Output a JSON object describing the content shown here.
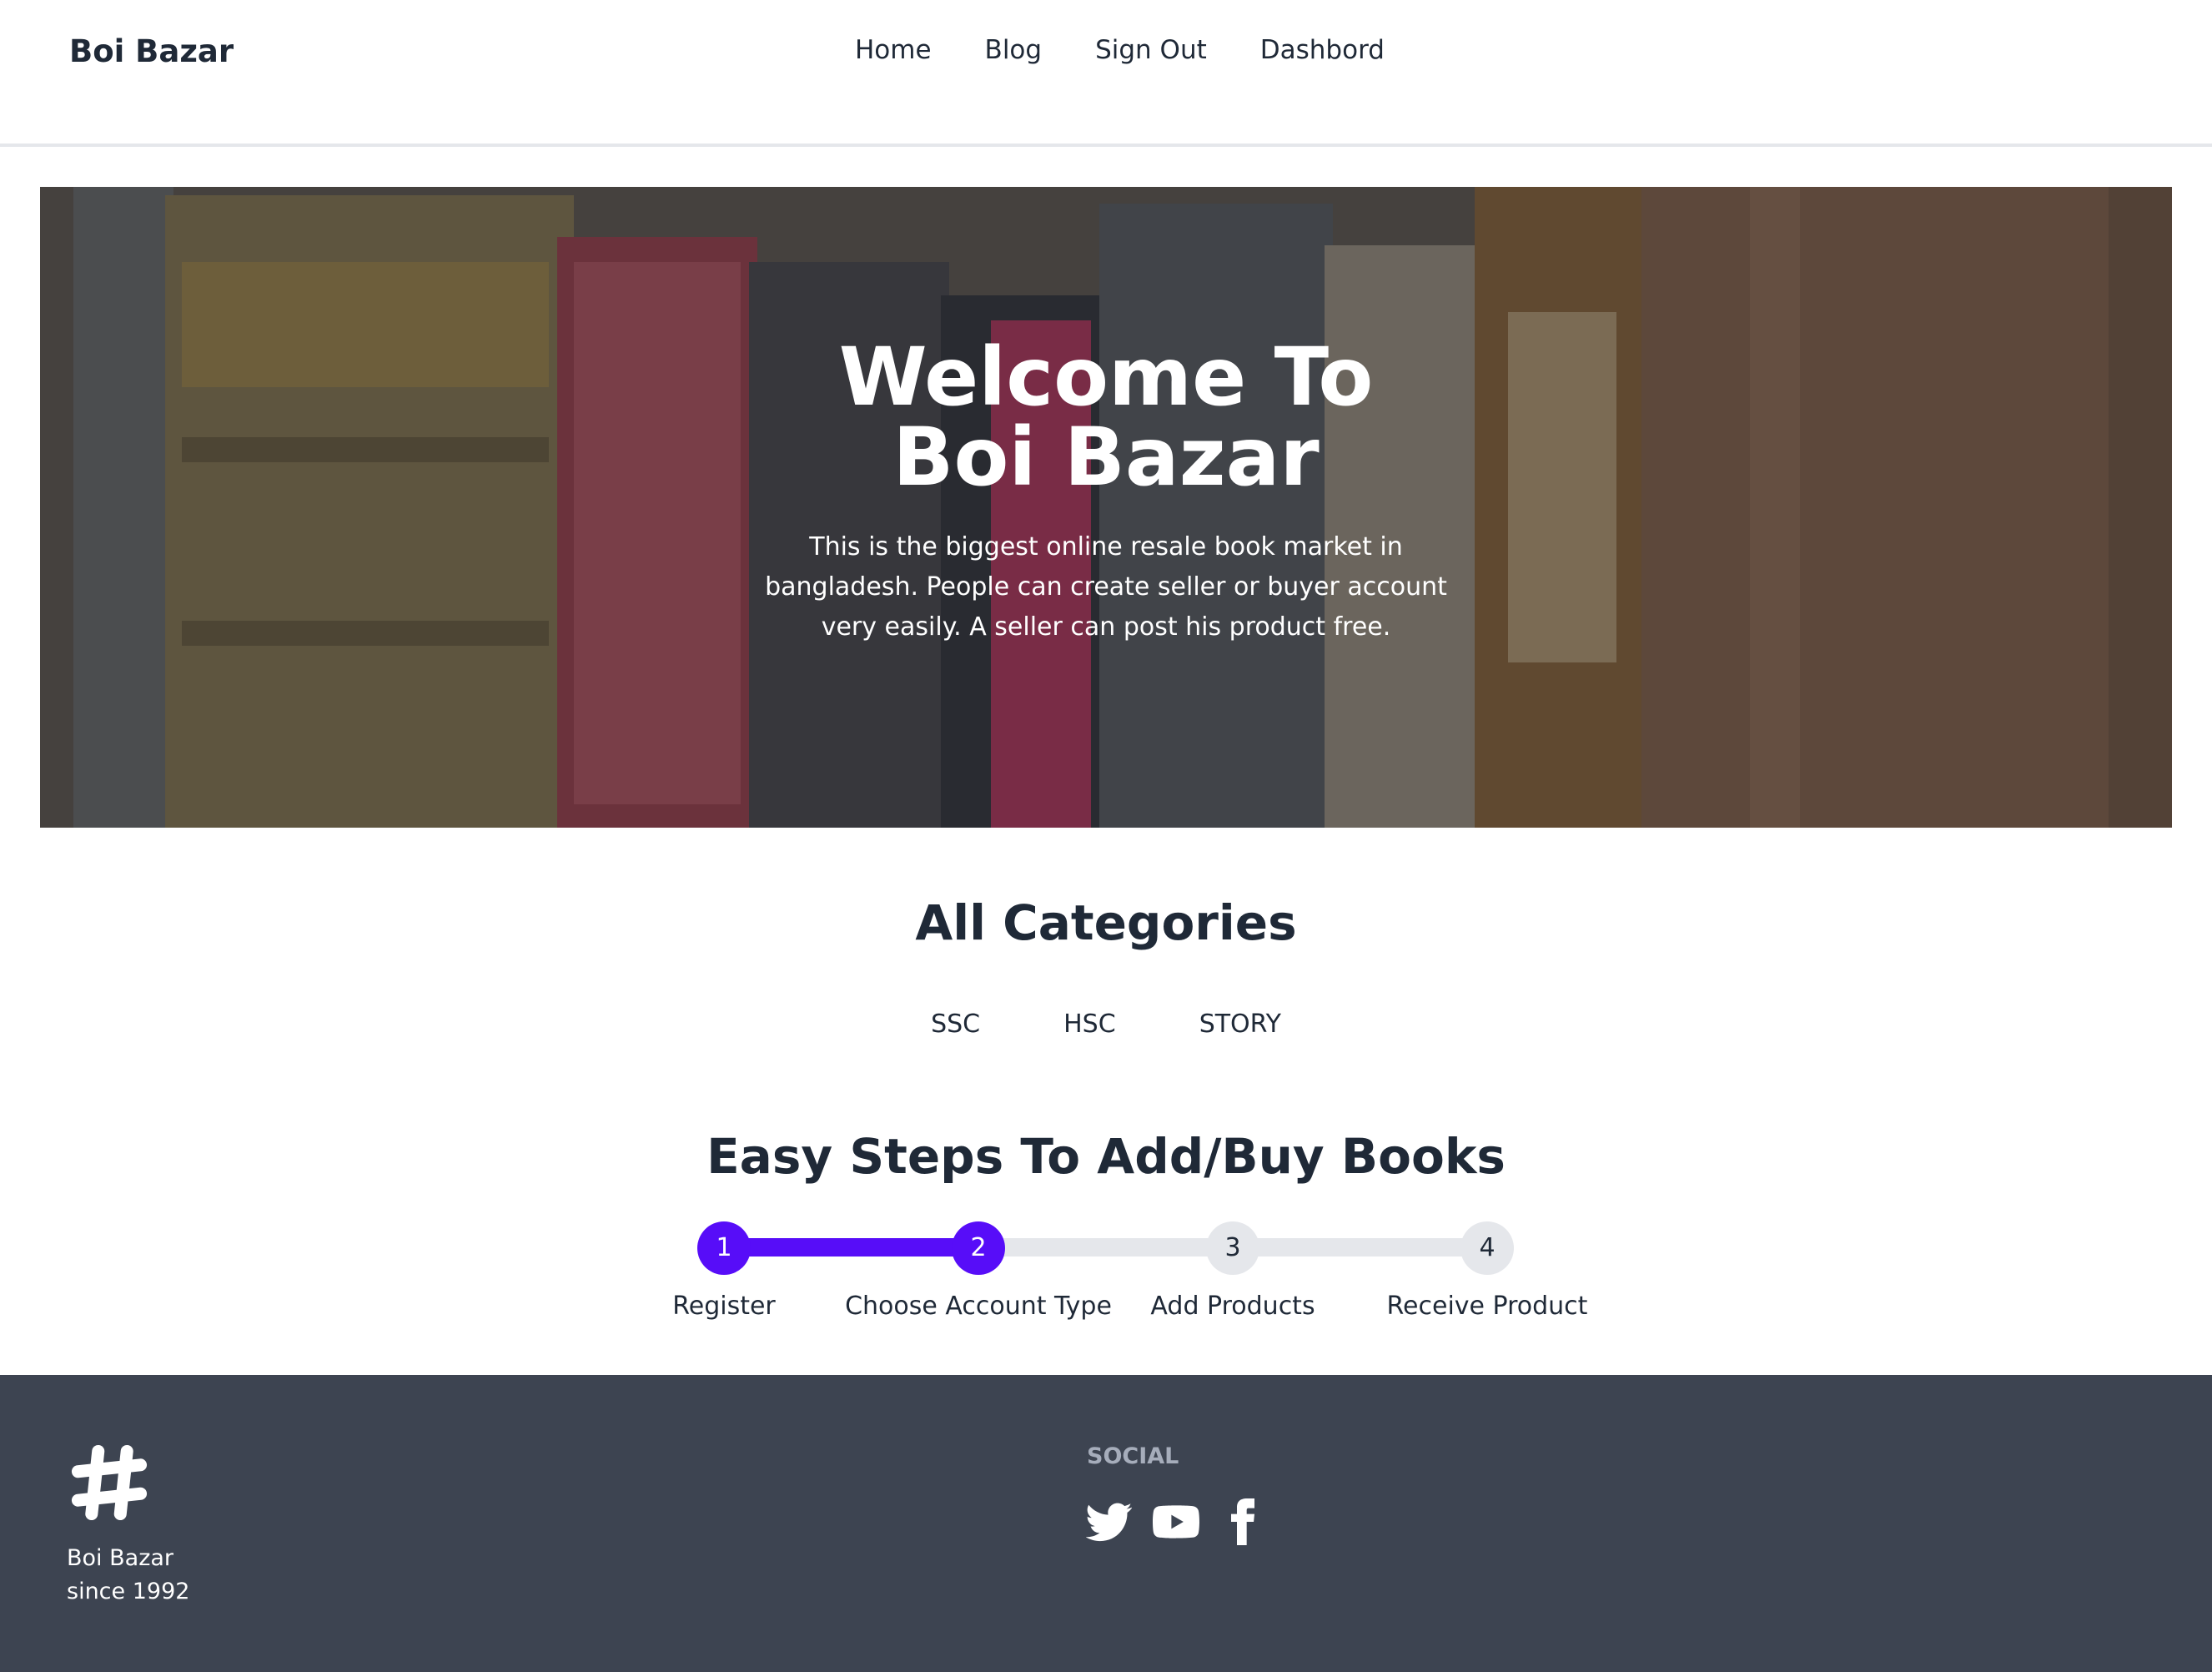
{
  "navbar": {
    "brand": "Boi Bazar",
    "links": [
      {
        "label": "Home"
      },
      {
        "label": "Blog"
      },
      {
        "label": "Sign Out"
      },
      {
        "label": "Dashbord"
      }
    ]
  },
  "hero": {
    "title": "Welcome To Boi Bazar",
    "text": "This is the biggest online resale book market in bangladesh. People can create seller or buyer account very easily. A seller can post his product free."
  },
  "categories": {
    "title": "All Categories",
    "items": [
      {
        "label": "SSC"
      },
      {
        "label": "HSC"
      },
      {
        "label": "STORY"
      }
    ]
  },
  "steps": {
    "title": "Easy Steps To Add/Buy Books",
    "completed": 2,
    "items": [
      {
        "number": "1",
        "label": "Register"
      },
      {
        "number": "2",
        "label": "Choose Account Type"
      },
      {
        "number": "3",
        "label": "Add Products"
      },
      {
        "number": "4",
        "label": "Receive Product"
      }
    ]
  },
  "footer": {
    "logo_icon": "hashtag-icon",
    "brand_line1": "Boi Bazar",
    "brand_line2": "since 1992",
    "social_title": "SOCIAL",
    "social_icons": [
      "twitter-icon",
      "youtube-icon",
      "facebook-icon"
    ]
  },
  "colors": {
    "primary": "#570df8",
    "footer_bg": "#3d4451",
    "text": "#1f2937",
    "step_inactive": "#e5e7eb"
  }
}
